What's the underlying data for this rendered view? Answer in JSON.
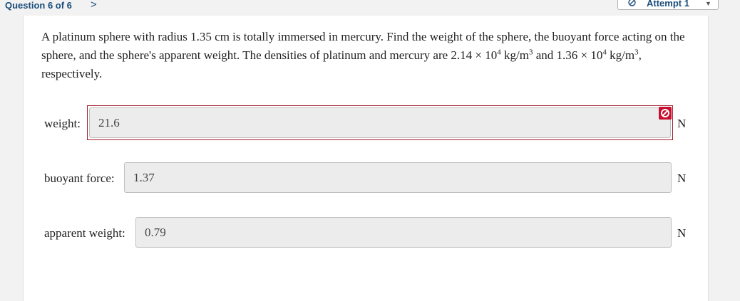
{
  "nav": {
    "question_label": "Question 6 of 6",
    "next_glyph": ">"
  },
  "attempt": {
    "label": "Attempt 1"
  },
  "question": {
    "part1": "A platinum sphere with radius 1.35 cm is totally immersed in mercury. Find the weight of the sphere, the buoyant force acting on the sphere, and the sphere's apparent weight. The densities of platinum and mercury are 2.14 × 10",
    "exp1": "4",
    "part2": " kg/m",
    "exp2": "3",
    "part3": " and 1.36 × 10",
    "exp3": "4",
    "part4": " kg/m",
    "exp4": "3",
    "part5": ", respectively."
  },
  "fields": {
    "weight": {
      "label": "weight:",
      "value": "21.6",
      "unit": "N",
      "status": "incorrect"
    },
    "buoyant": {
      "label": "buoyant force:",
      "value": "1.37",
      "unit": "N"
    },
    "apparent": {
      "label": "apparent weight:",
      "value": "0.79",
      "unit": "N"
    }
  },
  "colors": {
    "nav_text": "#1a4d7a",
    "incorrect": "#c8102e",
    "input_bg": "#ececec"
  }
}
